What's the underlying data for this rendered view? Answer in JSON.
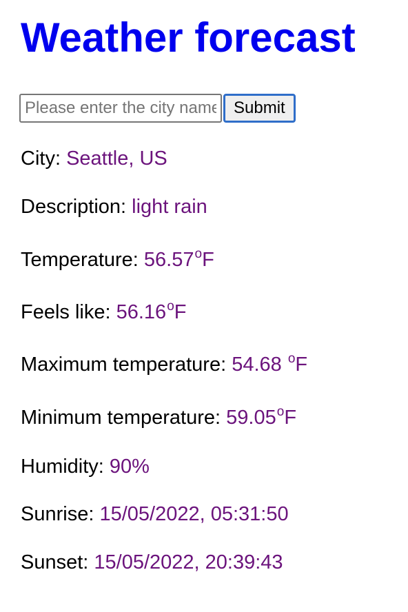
{
  "header": {
    "title": "Weather forecast"
  },
  "search": {
    "placeholder": "Please enter the city name",
    "value": "",
    "submit_label": "Submit"
  },
  "weather": {
    "city": {
      "label": "City:",
      "value": "Seattle, US"
    },
    "description": {
      "label": "Description:",
      "value": "light rain"
    },
    "temperature": {
      "label": "Temperature:",
      "value": "56.57",
      "deg": "o",
      "unit": "F"
    },
    "feels_like": {
      "label": "Feels like:",
      "value": "56.16",
      "deg": "o",
      "unit": "F"
    },
    "max_temperature": {
      "label": "Maximum temperature:",
      "value": "54.68 ",
      "deg": "o",
      "unit": "F"
    },
    "min_temperature": {
      "label": "Minimum temperature:",
      "value": "59.05",
      "deg": "o",
      "unit": "F"
    },
    "humidity": {
      "label": "Humidity:",
      "value": "90%"
    },
    "sunrise": {
      "label": "Sunrise:",
      "value": "15/05/2022, 05:31:50"
    },
    "sunset": {
      "label": "Sunset:",
      "value": "15/05/2022, 20:39:43"
    }
  },
  "colors": {
    "title": "#0000ee",
    "value": "#6b137c",
    "button_focus_border": "#2f6ec9"
  }
}
